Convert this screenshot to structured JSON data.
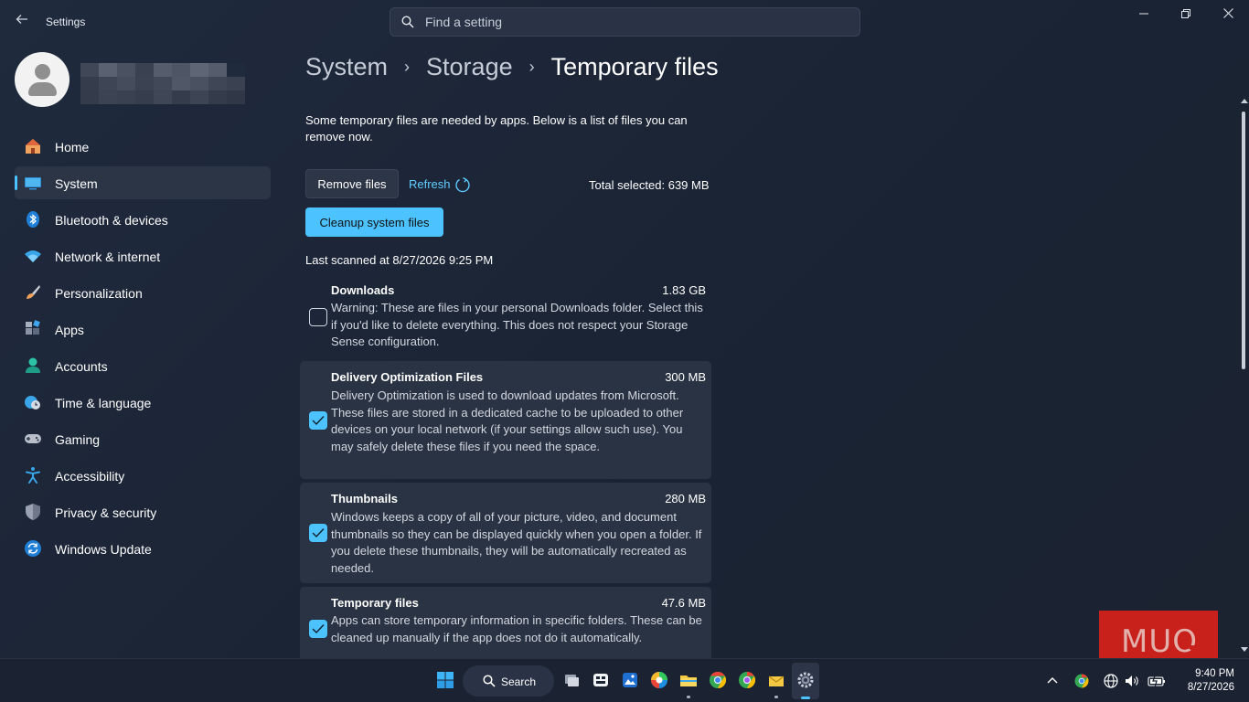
{
  "window": {
    "title": "Settings",
    "search_placeholder": "Find a setting"
  },
  "sidebar": {
    "items": [
      {
        "label": "Home",
        "icon": "home-icon"
      },
      {
        "label": "System",
        "icon": "system-icon",
        "active": true
      },
      {
        "label": "Bluetooth & devices",
        "icon": "bluetooth-icon"
      },
      {
        "label": "Network & internet",
        "icon": "wifi-icon"
      },
      {
        "label": "Personalization",
        "icon": "brush-icon"
      },
      {
        "label": "Apps",
        "icon": "apps-icon"
      },
      {
        "label": "Accounts",
        "icon": "accounts-icon"
      },
      {
        "label": "Time & language",
        "icon": "globe-clock-icon"
      },
      {
        "label": "Gaming",
        "icon": "gamepad-icon"
      },
      {
        "label": "Accessibility",
        "icon": "accessibility-icon"
      },
      {
        "label": "Privacy & security",
        "icon": "shield-icon"
      },
      {
        "label": "Windows Update",
        "icon": "update-icon"
      }
    ]
  },
  "breadcrumb": {
    "items": [
      "System",
      "Storage"
    ],
    "current": "Temporary files"
  },
  "main": {
    "description": "Some temporary files are needed by apps. Below is a list of files you can remove now.",
    "remove_label": "Remove files",
    "refresh_label": "Refresh",
    "total_selected": "Total selected: 639 MB",
    "cleanup_label": "Cleanup system files",
    "last_scanned": "Last scanned at 8/27/2026 9:25 PM",
    "files": [
      {
        "title": "Downloads",
        "size": "1.83 GB",
        "checked": false,
        "description": "Warning: These are files in your personal Downloads folder. Select this if you'd like to delete everything. This does not respect your Storage Sense configuration."
      },
      {
        "title": "Delivery Optimization Files",
        "size": "300 MB",
        "checked": true,
        "description": "Delivery Optimization is used to download updates from Microsoft. These files are stored in a dedicated cache to be uploaded to other devices on your local network (if your settings allow such use). You may safely delete these files if you need the space."
      },
      {
        "title": "Thumbnails",
        "size": "280 MB",
        "checked": true,
        "description": "Windows keeps a copy of all of your picture, video, and document thumbnails so they can be displayed quickly when you open a folder. If you delete these thumbnails, they will be automatically recreated as needed."
      },
      {
        "title": "Temporary files",
        "size": "47.6 MB",
        "checked": true,
        "description": "Apps can store temporary information in specific folders. These can be cleaned up manually if the app does not do it automatically."
      }
    ]
  },
  "watermark": {
    "text": "MUO"
  },
  "taskbar": {
    "search_label": "Search",
    "time": "9:40 PM",
    "date": "8/27/2026"
  },
  "colors": {
    "accent": "#4cc2ff",
    "background": "#1c2536",
    "card": "#2a3343",
    "watermark": "#c8201a"
  }
}
